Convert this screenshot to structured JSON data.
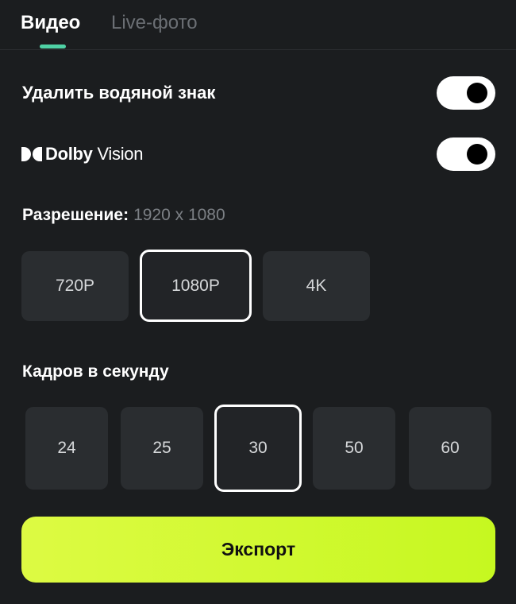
{
  "tabs": [
    {
      "label": "Видео",
      "active": true
    },
    {
      "label": "Live-фото",
      "active": false
    }
  ],
  "watermark": {
    "label": "Удалить водяной знак",
    "enabled": true
  },
  "dolby": {
    "brand": "Dolby",
    "product": "Vision",
    "enabled": true
  },
  "resolution": {
    "label": "Разрешение:",
    "value": "1920 x 1080",
    "options": [
      "720P",
      "1080P",
      "4K"
    ],
    "selected": "1080P"
  },
  "fps": {
    "label": "Кадров в секунду",
    "options": [
      "24",
      "25",
      "30",
      "50",
      "60"
    ],
    "selected": "30"
  },
  "export": {
    "label": "Экспорт"
  },
  "colors": {
    "background": "#1b1d1f",
    "accent_tab": "#4fd1a5",
    "export_button": "#d4f92f",
    "option_bg": "#2a2d30"
  }
}
